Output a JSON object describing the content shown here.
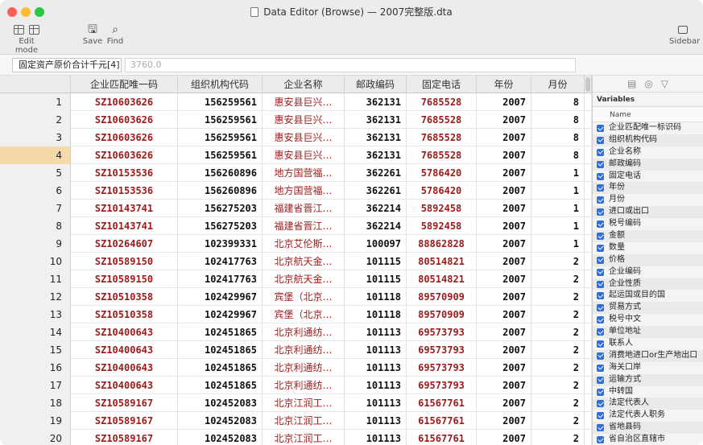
{
  "window": {
    "title": "Data Editor (Browse) — 2007完整版.dta"
  },
  "toolbar": {
    "edit_mode_label": "Edit mode",
    "save_label": "Save",
    "find_label": "Find",
    "sidebar_label": "Sidebar"
  },
  "cmdbar": {
    "current_var": "固定资产原价合计千元[4]",
    "current_value": "3760.0"
  },
  "columns": [
    "企业匹配唯一码",
    "组织机构代码",
    "企业名称",
    "邮政编码",
    "固定电话",
    "年份",
    "月份"
  ],
  "rows": [
    {
      "n": "1",
      "a": "SZ10603626",
      "b": "156259561",
      "c": "惠安县巨兴…",
      "d": "362131",
      "e": "7685528",
      "f": "2007",
      "g": "8"
    },
    {
      "n": "2",
      "a": "SZ10603626",
      "b": "156259561",
      "c": "惠安县巨兴…",
      "d": "362131",
      "e": "7685528",
      "f": "2007",
      "g": "8"
    },
    {
      "n": "3",
      "a": "SZ10603626",
      "b": "156259561",
      "c": "惠安县巨兴…",
      "d": "362131",
      "e": "7685528",
      "f": "2007",
      "g": "8"
    },
    {
      "n": "4",
      "a": "SZ10603626",
      "b": "156259561",
      "c": "惠安县巨兴…",
      "d": "362131",
      "e": "7685528",
      "f": "2007",
      "g": "8"
    },
    {
      "n": "5",
      "a": "SZ10153536",
      "b": "156260896",
      "c": "地方国营福…",
      "d": "362261",
      "e": "5786420",
      "f": "2007",
      "g": "1"
    },
    {
      "n": "6",
      "a": "SZ10153536",
      "b": "156260896",
      "c": "地方国营福…",
      "d": "362261",
      "e": "5786420",
      "f": "2007",
      "g": "1"
    },
    {
      "n": "7",
      "a": "SZ10143741",
      "b": "156275203",
      "c": "福建省晋江…",
      "d": "362214",
      "e": "5892458",
      "f": "2007",
      "g": "1"
    },
    {
      "n": "8",
      "a": "SZ10143741",
      "b": "156275203",
      "c": "福建省晋江…",
      "d": "362214",
      "e": "5892458",
      "f": "2007",
      "g": "1"
    },
    {
      "n": "9",
      "a": "SZ10264607",
      "b": "102399331",
      "c": "北京艾伦斯…",
      "d": "100097",
      "e": "88862828",
      "f": "2007",
      "g": "1"
    },
    {
      "n": "10",
      "a": "SZ10589150",
      "b": "102417763",
      "c": "北京航天金…",
      "d": "101115",
      "e": "80514821",
      "f": "2007",
      "g": "2"
    },
    {
      "n": "11",
      "a": "SZ10589150",
      "b": "102417763",
      "c": "北京航天金…",
      "d": "101115",
      "e": "80514821",
      "f": "2007",
      "g": "2"
    },
    {
      "n": "12",
      "a": "SZ10510358",
      "b": "102429967",
      "c": "宾堡（北京…",
      "d": "101118",
      "e": "89570909",
      "f": "2007",
      "g": "2"
    },
    {
      "n": "13",
      "a": "SZ10510358",
      "b": "102429967",
      "c": "宾堡（北京…",
      "d": "101118",
      "e": "89570909",
      "f": "2007",
      "g": "2"
    },
    {
      "n": "14",
      "a": "SZ10400643",
      "b": "102451865",
      "c": "北京利通纺…",
      "d": "101113",
      "e": "69573793",
      "f": "2007",
      "g": "2"
    },
    {
      "n": "15",
      "a": "SZ10400643",
      "b": "102451865",
      "c": "北京利通纺…",
      "d": "101113",
      "e": "69573793",
      "f": "2007",
      "g": "2"
    },
    {
      "n": "16",
      "a": "SZ10400643",
      "b": "102451865",
      "c": "北京利通纺…",
      "d": "101113",
      "e": "69573793",
      "f": "2007",
      "g": "2"
    },
    {
      "n": "17",
      "a": "SZ10400643",
      "b": "102451865",
      "c": "北京利通纺…",
      "d": "101113",
      "e": "69573793",
      "f": "2007",
      "g": "2"
    },
    {
      "n": "18",
      "a": "SZ10589167",
      "b": "102452083",
      "c": "北京江润工…",
      "d": "101113",
      "e": "61567761",
      "f": "2007",
      "g": "2"
    },
    {
      "n": "19",
      "a": "SZ10589167",
      "b": "102452083",
      "c": "北京江润工…",
      "d": "101113",
      "e": "61567761",
      "f": "2007",
      "g": "2"
    },
    {
      "n": "20",
      "a": "SZ10589167",
      "b": "102452083",
      "c": "北京江润工…",
      "d": "101113",
      "e": "61567761",
      "f": "2007",
      "g": "2"
    }
  ],
  "selected_row": "4",
  "sidebar": {
    "title": "Variables",
    "name_header": "Name",
    "variables": [
      "企业匹配唯一标识码",
      "组织机构代码",
      "企业名称",
      "邮政编码",
      "固定电话",
      "年份",
      "月份",
      "进口或出口",
      "税号编码",
      "金额",
      "数量",
      "价格",
      "企业编码",
      "企业性质",
      "起运国或目的国",
      "贸易方式",
      "税号中文",
      "单位地址",
      "联系人",
      "消费地进口or生产地出口",
      "海关口岸",
      "运输方式",
      "中转国",
      "法定代表人",
      "法定代表人职务",
      "省地县码",
      "省自治区直辖市"
    ]
  },
  "colors": {
    "string_text": "#9b1b1b",
    "selected_row": "#f6d9a8",
    "checkbox": "#2f6fd6"
  }
}
